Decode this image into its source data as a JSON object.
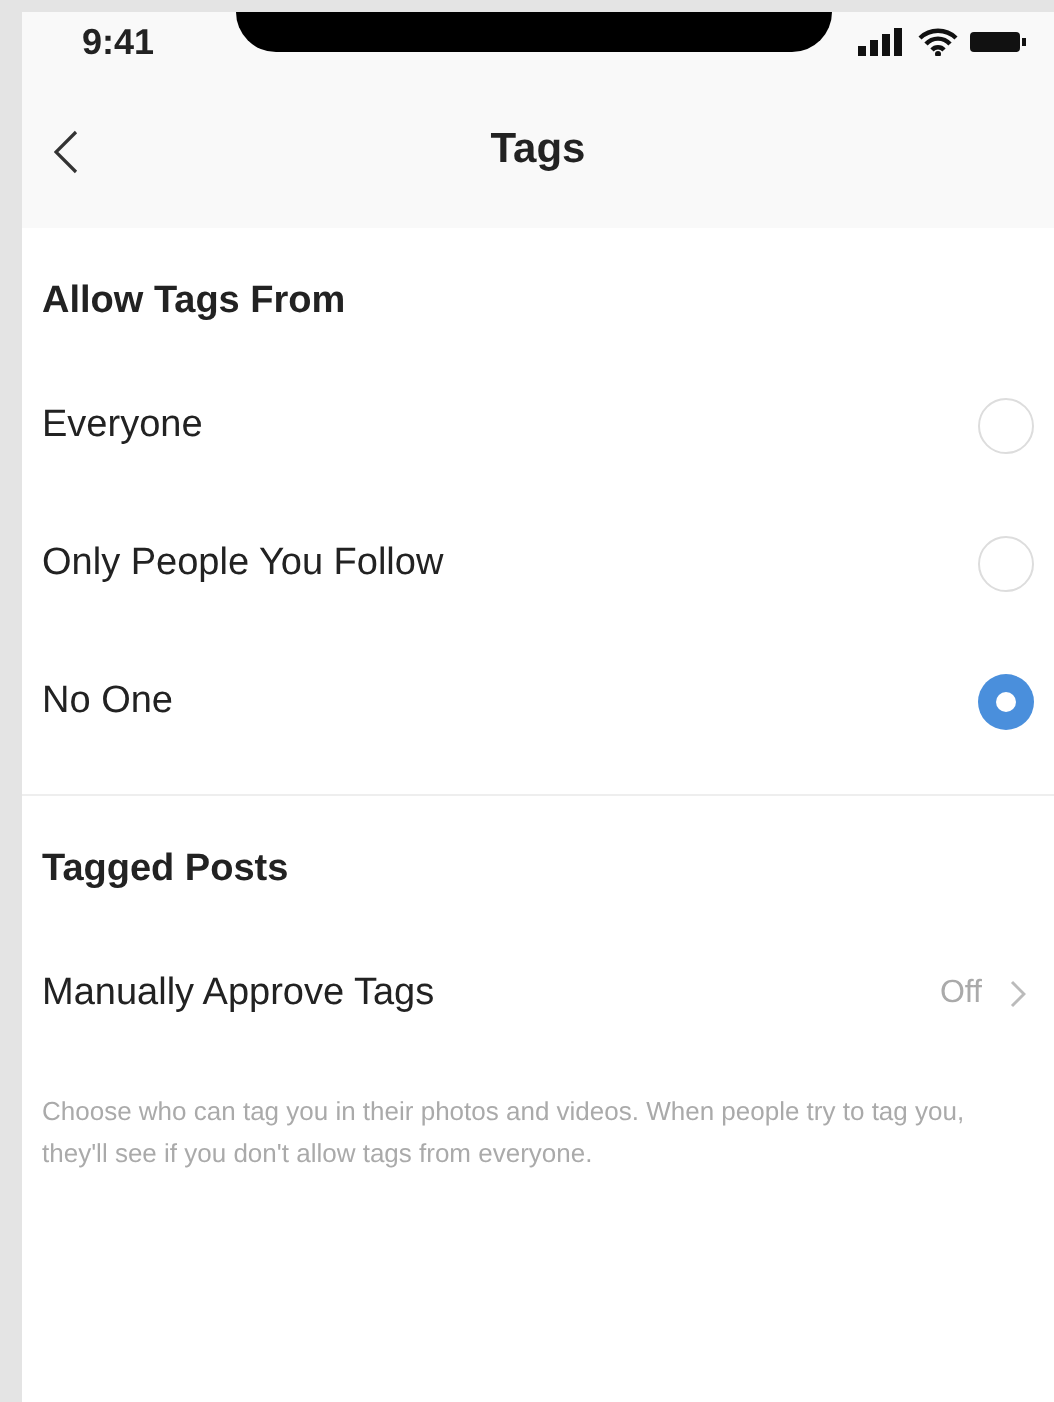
{
  "status_bar": {
    "time": "9:41"
  },
  "nav": {
    "title": "Tags"
  },
  "sections": [
    {
      "title": "Allow Tags From",
      "rows": [
        {
          "kind": "radio",
          "label": "Everyone",
          "selected": false
        },
        {
          "kind": "radio",
          "label": "Only People You Follow",
          "selected": false
        },
        {
          "kind": "radio",
          "label": "No One",
          "selected": true
        }
      ]
    },
    {
      "title": "Tagged Posts",
      "rows": [
        {
          "kind": "link",
          "label": "Manually Approve Tags",
          "value": "Off"
        }
      ]
    }
  ],
  "footer": "Choose who can tag you in their photos and videos. When people try to tag you, they'll see if you don't allow tags from everyone."
}
